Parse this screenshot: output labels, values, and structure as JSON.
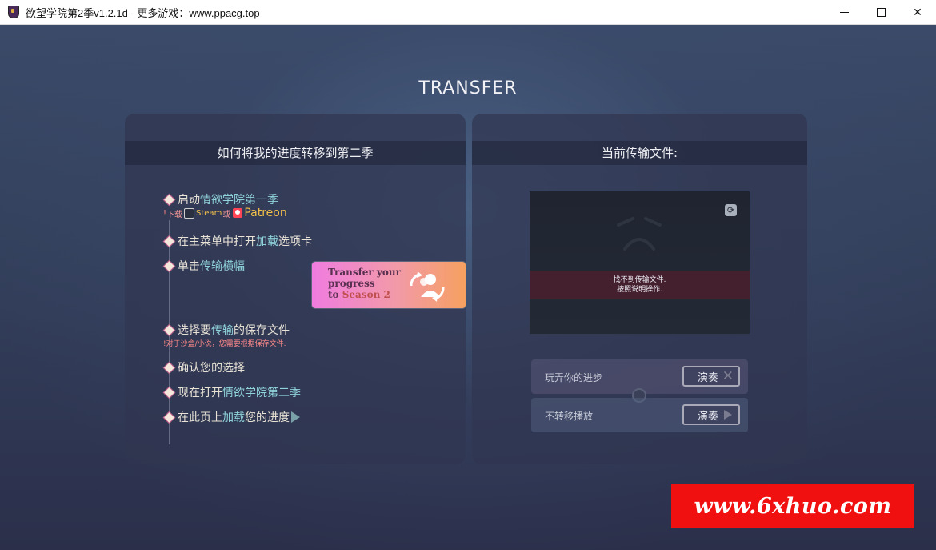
{
  "window": {
    "title": "欲望学院第2季v1.2.1d - 更多游戏：www.ppacg.top"
  },
  "heading": "TRANSFER",
  "left_panel": {
    "header": "如何将我的进度转移到第二季",
    "steps": [
      {
        "prefix": "启动",
        "highlight": "情欲学院第一季",
        "suffix": ""
      },
      {
        "prefix": "在主菜单中打开",
        "highlight": "加载",
        "suffix": "选项卡"
      },
      {
        "prefix": "单击",
        "highlight": "传输",
        "suffix": "横幅"
      },
      {
        "prefix": "选择要",
        "highlight": "传输",
        "suffix": "的保存文件"
      },
      {
        "prefix": "确认您的选择",
        "highlight": "",
        "suffix": ""
      },
      {
        "prefix": "现在打开",
        "highlight": "情欲学院第二季",
        "suffix": ""
      },
      {
        "prefix": "在此页上",
        "highlight": "加载",
        "suffix": "您的进度"
      }
    ],
    "download_note": {
      "mark": "!",
      "label": "下载",
      "steam": "Steam",
      "or": "或",
      "patreon": "Patreon"
    },
    "sandbox_note": "!对于沙盒/小说，您需要根据保存文件.",
    "banner": {
      "line1": "Transfer your",
      "line2": "progress",
      "line3": "to",
      "season": "Season 2"
    }
  },
  "right_panel": {
    "header": "当前传输文件:",
    "error_line1": "找不到传输文件.",
    "error_line2": "按照说明操作.",
    "options": [
      {
        "label": "玩弄你的进步",
        "button": "演奏",
        "icon": "x-icon"
      },
      {
        "label": "不转移播放",
        "button": "演奏",
        "icon": "play-icon"
      }
    ]
  },
  "watermark": "www.6xhuo.com",
  "colors": {
    "highlight": "#8fd2d8",
    "accent_gold": "#f5c04a",
    "watermark_bg": "#f01010"
  }
}
